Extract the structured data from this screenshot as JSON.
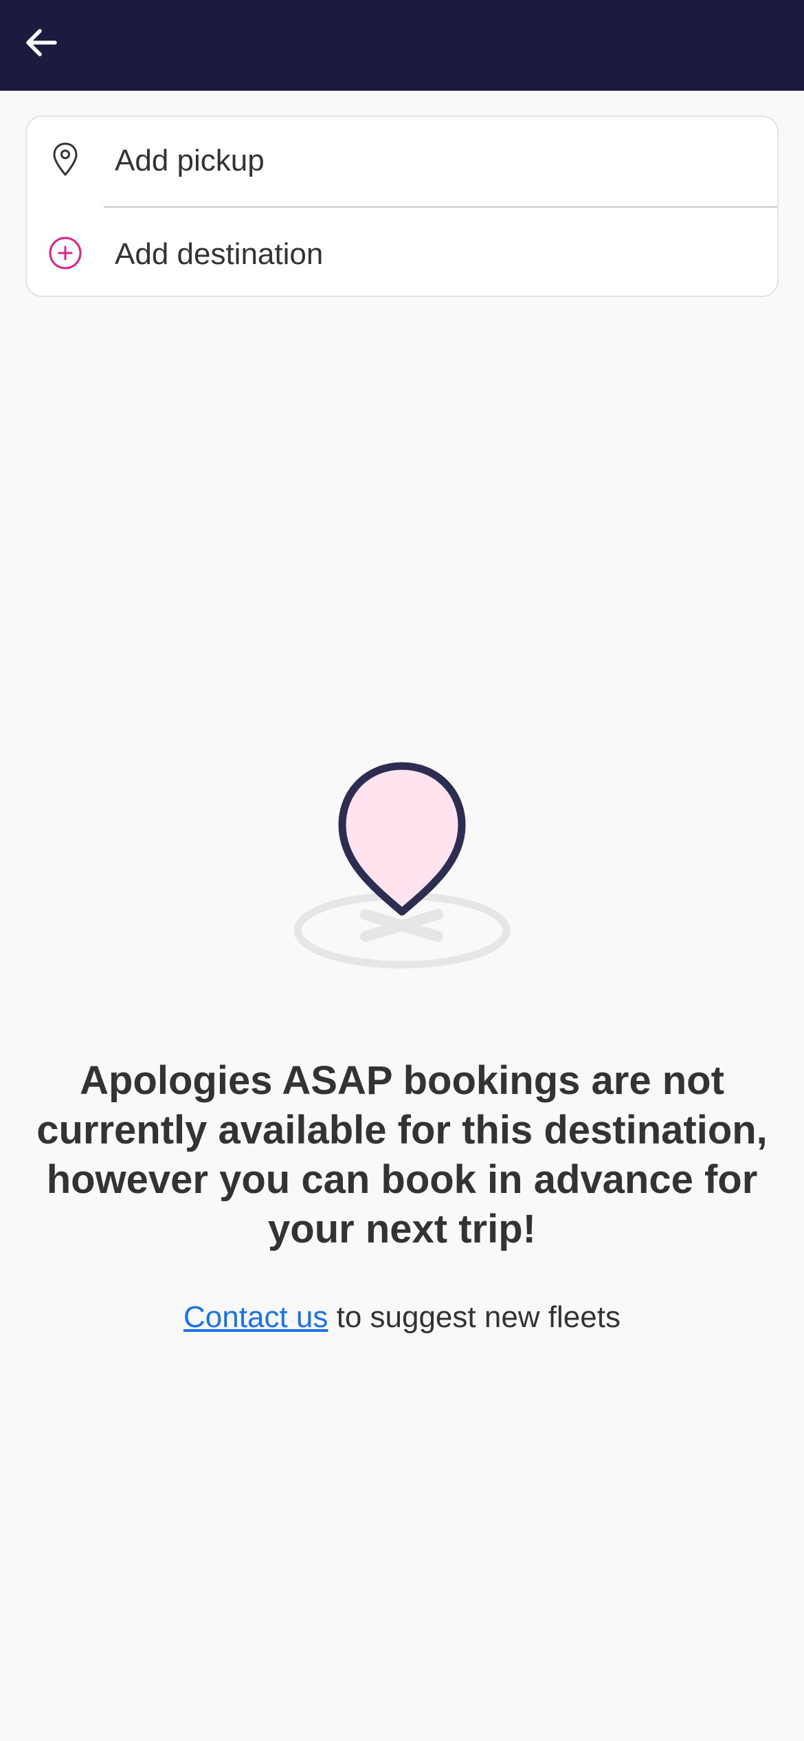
{
  "header": {
    "back_icon": "arrow-left-icon",
    "background_color": "#1b1a3f"
  },
  "route_card": {
    "pickup": {
      "icon": "map-pin-outline-icon",
      "label": "Add pickup"
    },
    "destination": {
      "icon": "plus-circle-icon",
      "icon_color": "#e0218a",
      "label": "Add destination"
    }
  },
  "empty_state": {
    "illustration": "location-pin-illustration",
    "message": "Apologies ASAP bookings are not currently available for this destination, however you can book in advance for your next trip!",
    "contact_link_label": "Contact us",
    "contact_suffix": " to suggest new fleets",
    "link_color": "#1a73e8"
  }
}
